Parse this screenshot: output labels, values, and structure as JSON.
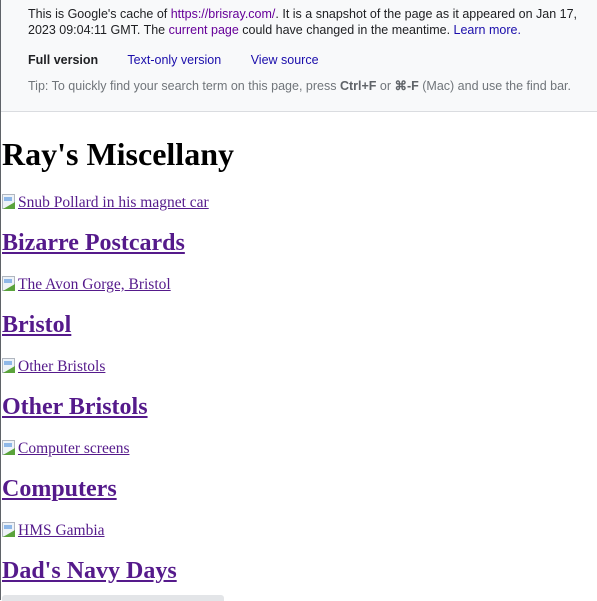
{
  "cache_header": {
    "line1_prefix": "This is Google's cache of ",
    "cached_url": "https://brisray.com/",
    "line1_suffix": ". It is a snapshot of the page as it appeared on Jan 17,",
    "line2_prefix": "2023 09:04:11 GMT. The ",
    "current_page_link": "current page",
    "line2_middle": " could have changed in the meantime. ",
    "learn_more_link": "Learn more.",
    "versions": {
      "full": "Full version",
      "text_only": "Text-only version",
      "view_source": "View source"
    },
    "tip": {
      "prefix": "Tip: To quickly find your search term on this page, press ",
      "ctrl_f": "Ctrl+F",
      "or": " or ",
      "cmd_f": "⌘-F",
      "suffix": " (Mac) and use the find bar."
    }
  },
  "page": {
    "title": "Ray's Miscellany",
    "sections": [
      {
        "image_alt": "Snub Pollard in his magnet car",
        "heading": "Bizarre Postcards"
      },
      {
        "image_alt": "The Avon Gorge, Bristol",
        "heading": "Bristol"
      },
      {
        "image_alt": "Other Bristols",
        "heading": "Other Bristols"
      },
      {
        "image_alt": "Computer screens",
        "heading": "Computers"
      },
      {
        "image_alt": "HMS Gambia",
        "heading": "Dad's Navy Days"
      }
    ]
  }
}
